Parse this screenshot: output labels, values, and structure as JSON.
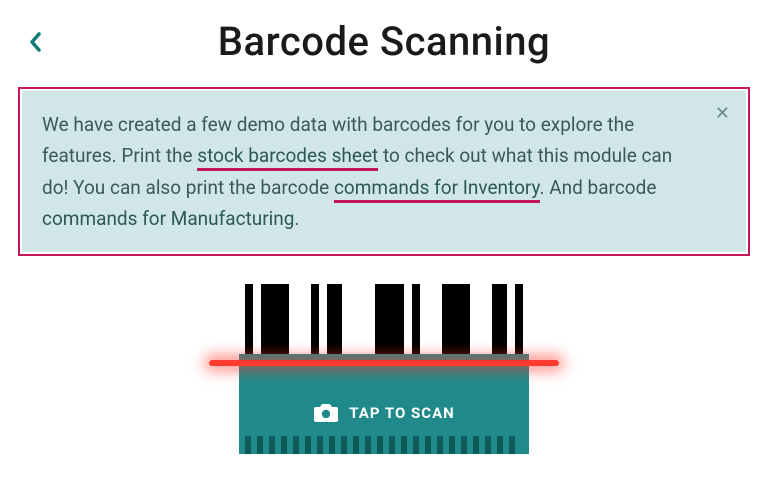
{
  "header": {
    "title": "Barcode Scanning"
  },
  "info": {
    "text_before_link1": "We have created a few demo data with barcodes for you to explore the features. Print the ",
    "link1": "stock barcodes sheet",
    "text_between_1_2": " to check out what this module can do! You can also print the barcode ",
    "link2": "commands for Inventory",
    "text_between_2_3": ". And barcode ",
    "link3": "commands for Manufacturing",
    "text_after": "."
  },
  "scanner": {
    "label": "TAP TO SCAN"
  },
  "colors": {
    "accent_teal": "#1f8a89",
    "highlight_pink": "#c2185b",
    "scan_red": "#ff3b30",
    "info_bg": "#d1e7e7"
  }
}
